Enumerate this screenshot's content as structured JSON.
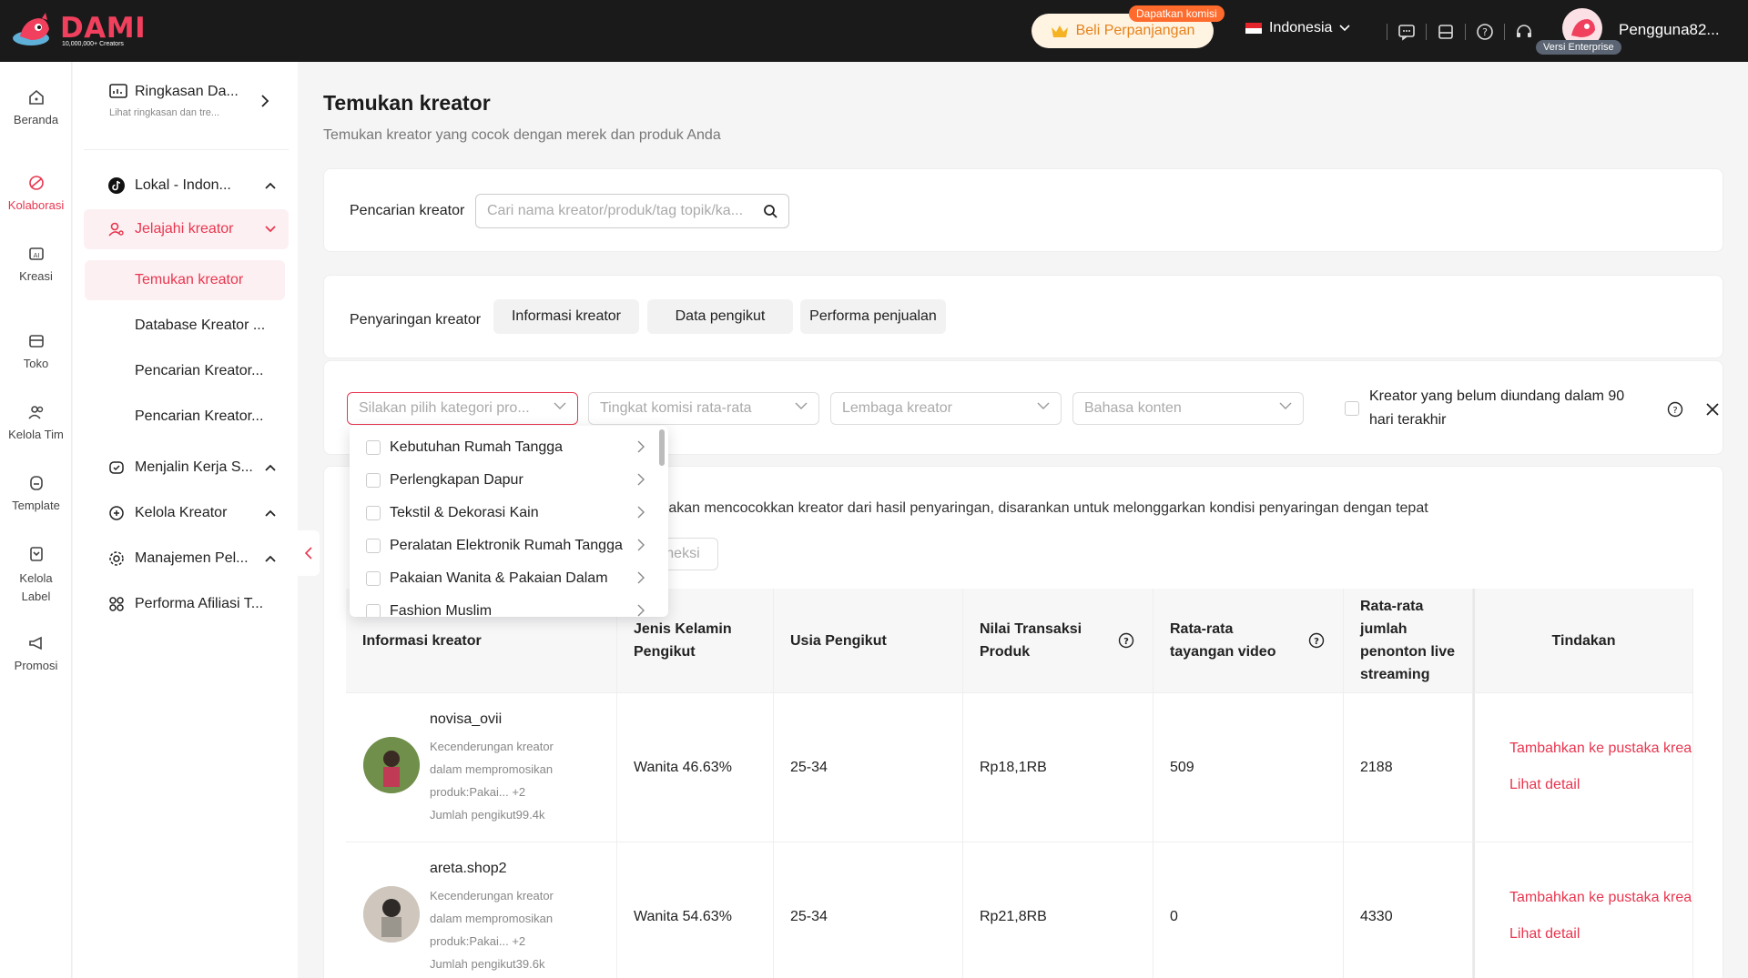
{
  "brand": {
    "name": "DAMI",
    "tagline": "10,000,000+ Creators",
    "accent": "#e8364f"
  },
  "topbar": {
    "renew_label": "Beli Perpanjangan",
    "commission_badge": "Dapatkan komisi",
    "country": "Indonesia",
    "enterprise_badge": "Versi Enterprise",
    "username": "Pengguna82...",
    "icons": [
      "chat-icon",
      "book-icon",
      "help-icon",
      "headset-icon"
    ]
  },
  "rail": [
    {
      "label": "Beranda",
      "icon": "home-icon"
    },
    {
      "label": "Kolaborasi",
      "icon": "collab-icon",
      "active": true
    },
    {
      "label": "Kreasi",
      "icon": "ai-icon"
    },
    {
      "label": "Toko",
      "icon": "store-icon"
    },
    {
      "label": "Kelola Tim",
      "icon": "team-icon"
    },
    {
      "label": "Template",
      "icon": "template-icon"
    },
    {
      "label": "Kelola Label",
      "icon": "label-icon"
    },
    {
      "label": "Promosi",
      "icon": "megaphone-icon"
    }
  ],
  "menu": {
    "summary_title": "Ringkasan Da...",
    "summary_sub": "Lihat ringkasan dan tre...",
    "local": "Lokal - Indon...",
    "explore": "Jelajahi kreator",
    "sub_items": [
      "Temukan kreator",
      "Database Kreator ...",
      "Pencarian Kreator...",
      "Pencarian Kreator..."
    ],
    "collab": "Menjalin Kerja S...",
    "manage": "Kelola Kreator",
    "management": "Manajemen Pel...",
    "affiliate": "Performa Afiliasi T..."
  },
  "page": {
    "title": "Temukan kreator",
    "subtitle": "Temukan kreator yang cocok dengan merek dan produk Anda"
  },
  "search": {
    "label": "Pencarian kreator",
    "placeholder": "Cari nama kreator/produk/tag topik/ka..."
  },
  "filter": {
    "label": "Penyaringan kreator",
    "tabs": [
      "Informasi kreator",
      "Data pengikut",
      "Performa penjualan"
    ],
    "selects": [
      "Silakan pilih kategori pro...",
      "Tingkat komisi rata-rata",
      "Lembaga kreator",
      "Bahasa konten"
    ],
    "recent_label": "Kreator yang belum diundang dalam 90 hari terakhir"
  },
  "results": {
    "notice": "Sistem akan mencocokkan kreator dari hasil penyaringan, disarankan untuk melonggarkan kondisi penyaringan dengan tepat",
    "task_btn": "at tugas koneksi"
  },
  "table": {
    "headers": [
      "Informasi kreator",
      "Jenis Kelamin Pengikut",
      "Usia Pengikut",
      "Nilai Transaksi Produk",
      "Rata-rata tayangan video",
      "Rata-rata jumlah penonton live streaming",
      "Tindakan"
    ],
    "rows": [
      {
        "name": "novisa_ovii",
        "desc": "Kecenderungan kreator dalam mempromosikan produk:Pakai... +2",
        "followers": "Jumlah pengikut99.4k",
        "gender": "Wanita 46.63%",
        "age": "25-34",
        "gmv": "Rp18,1RB",
        "views": "509",
        "live": "2188"
      },
      {
        "name": "areta.shop2",
        "desc": "Kecenderungan kreator dalam mempromosikan produk:Pakai... +2",
        "followers": "Jumlah pengikut39.6k",
        "gender": "Wanita 54.63%",
        "age": "25-34",
        "gmv": "Rp21,8RB",
        "views": "0",
        "live": "4330"
      }
    ],
    "action_add": "Tambahkan ke pustaka krea",
    "action_detail": "Lihat detail"
  },
  "dropdown": {
    "items": [
      "Kebutuhan Rumah Tangga",
      "Perlengkapan Dapur",
      "Tekstil & Dekorasi Kain",
      "Peralatan Elektronik Rumah Tangga",
      "Pakaian Wanita & Pakaian Dalam",
      "Fashion Muslim"
    ]
  }
}
